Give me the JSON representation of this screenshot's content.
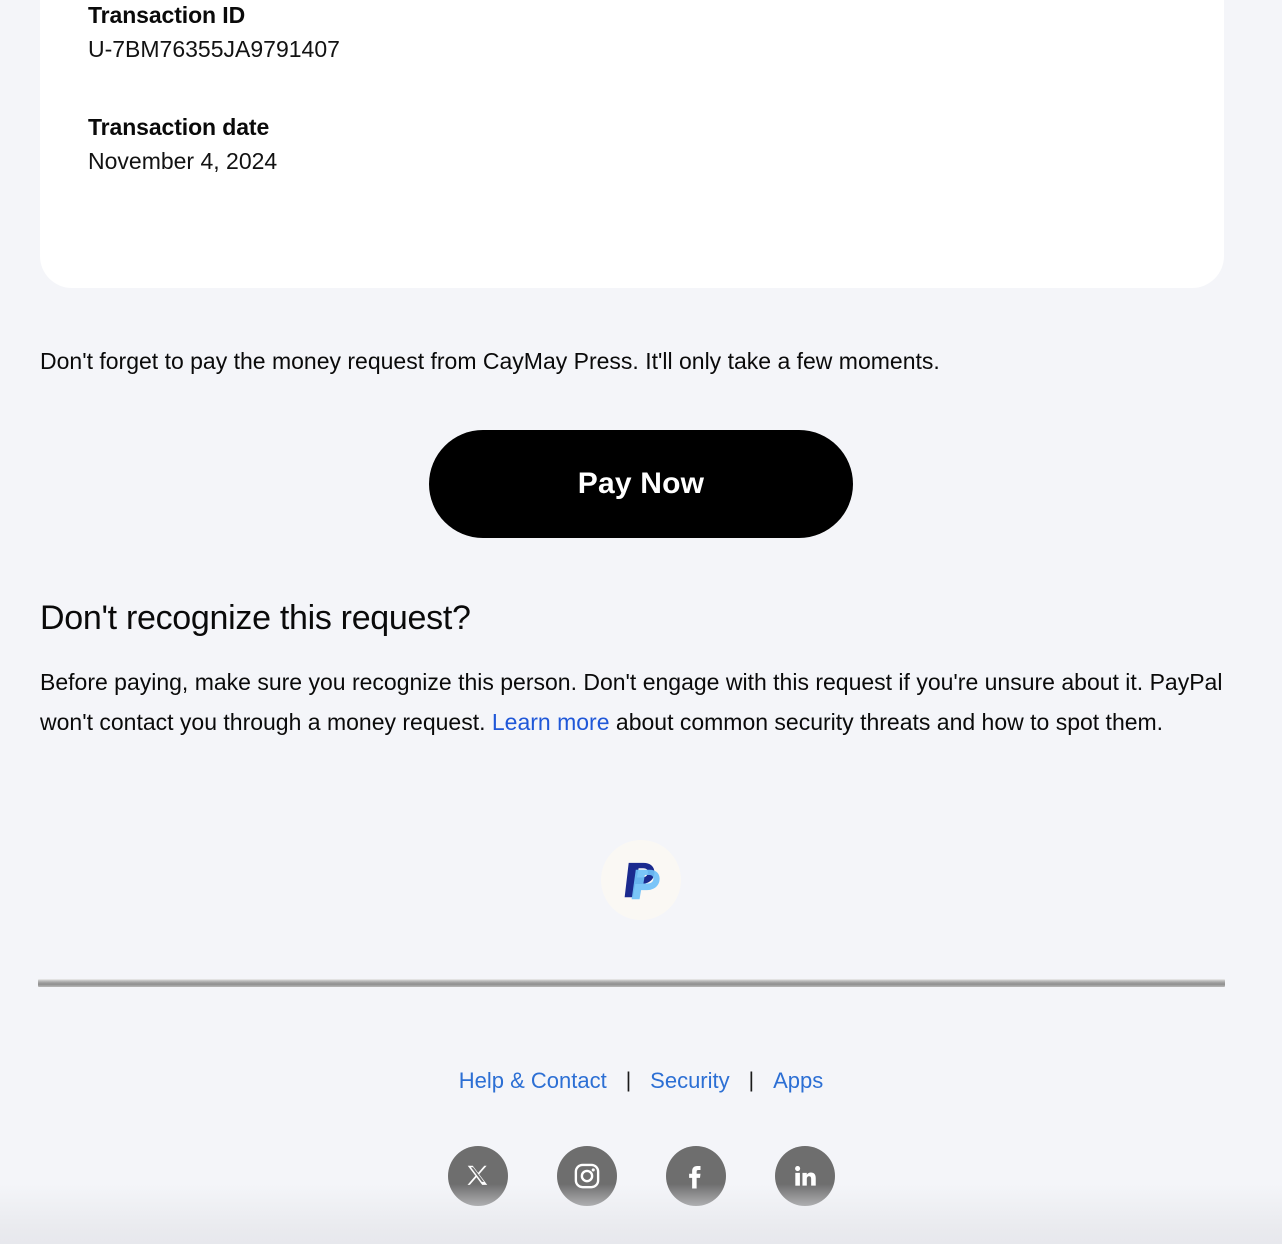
{
  "transaction_card": {
    "fields": [
      {
        "label": "Transaction ID",
        "value": "U-7BM76355JA9791407"
      },
      {
        "label": "Transaction date",
        "value": "November 4, 2024"
      }
    ]
  },
  "reminder": {
    "text": "Don't forget to pay the money request from CayMay Press. It'll only take a few moments."
  },
  "pay_button": {
    "label": "Pay Now",
    "background_color": "#000000",
    "text_color": "#ffffff"
  },
  "recognize_section": {
    "heading": "Don't recognize this request?",
    "body_part_1": "Before paying, make sure you recognize this person. Don't engage with this request if you're unsure about it. PayPal won't contact you through a money request. ",
    "link_label": "Learn more",
    "body_part_2": " about common security threats and how to spot them.",
    "link_color": "#1f57d8"
  },
  "brand": {
    "logo_icon": "paypal-logo-icon",
    "badge_color": "#faf8f4",
    "mark_dark_color": "#1a2a8f",
    "mark_light_color": "#6fc0f7"
  },
  "footer": {
    "links": [
      {
        "label": "Help & Contact",
        "name": "help-and-contact-link"
      },
      {
        "label": "Security",
        "name": "security-link"
      },
      {
        "label": "Apps",
        "name": "apps-link"
      }
    ],
    "separator": "|",
    "link_color": "#2c6fd4",
    "social": [
      {
        "name": "x-twitter-icon",
        "label": "X"
      },
      {
        "name": "instagram-icon",
        "label": "Instagram"
      },
      {
        "name": "facebook-icon",
        "label": "Facebook"
      },
      {
        "name": "linkedin-icon",
        "label": "LinkedIn"
      }
    ],
    "social_color": "#6e6e6e"
  }
}
